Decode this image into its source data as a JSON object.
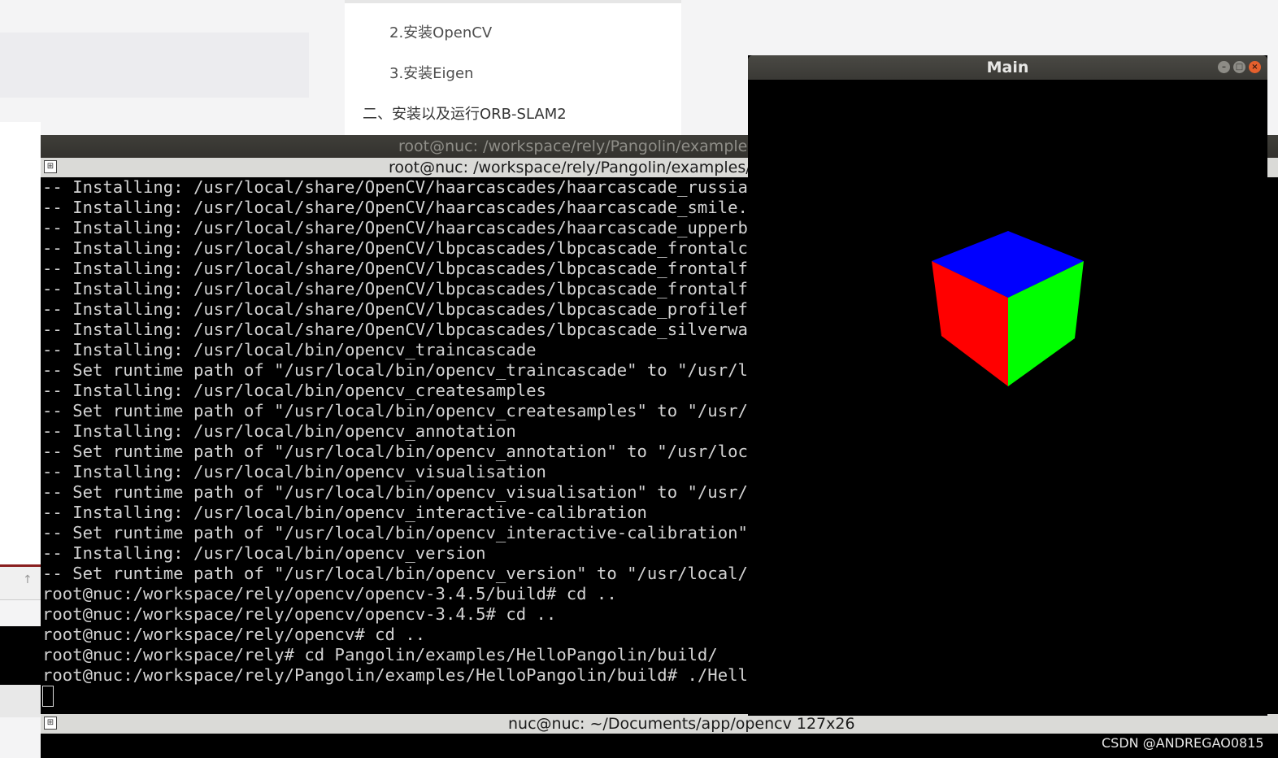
{
  "browser": {
    "toc": [
      {
        "label": "2.安装OpenCV"
      },
      {
        "label": "3.安装Eigen"
      },
      {
        "label": "二、安装以及运行ORB-SLAM2"
      }
    ]
  },
  "terminal": {
    "window_title": "root@nuc: /workspace/rely/Pangolin/examples/HelloPangolin/build",
    "tab_title": "root@nuc: /workspace/rely/Pangolin/examples/HelloPangolin/build",
    "lines": [
      "-- Installing: /usr/local/share/OpenCV/haarcascades/haarcascade_russian_p",
      "-- Installing: /usr/local/share/OpenCV/haarcascades/haarcascade_smile.xml",
      "-- Installing: /usr/local/share/OpenCV/haarcascades/haarcascade_upperbody",
      "-- Installing: /usr/local/share/OpenCV/lbpcascades/lbpcascade_frontalcatf",
      "-- Installing: /usr/local/share/OpenCV/lbpcascades/lbpcascade_frontalface",
      "-- Installing: /usr/local/share/OpenCV/lbpcascades/lbpcascade_frontalface",
      "-- Installing: /usr/local/share/OpenCV/lbpcascades/lbpcascade_profileface",
      "-- Installing: /usr/local/share/OpenCV/lbpcascades/lbpcascade_silverware.",
      "-- Installing: /usr/local/bin/opencv_traincascade",
      "-- Set runtime path of \"/usr/local/bin/opencv_traincascade\" to \"/usr/loca",
      "-- Installing: /usr/local/bin/opencv_createsamples",
      "-- Set runtime path of \"/usr/local/bin/opencv_createsamples\" to \"/usr/loc",
      "-- Installing: /usr/local/bin/opencv_annotation",
      "-- Set runtime path of \"/usr/local/bin/opencv_annotation\" to \"/usr/local/",
      "-- Installing: /usr/local/bin/opencv_visualisation",
      "-- Set runtime path of \"/usr/local/bin/opencv_visualisation\" to \"/usr/local/lib\"",
      "-- Installing: /usr/local/bin/opencv_interactive-calibration",
      "-- Set runtime path of \"/usr/local/bin/opencv_interactive-calibration\" to \"/usr/local/lib\"",
      "-- Installing: /usr/local/bin/opencv_version",
      "-- Set runtime path of \"/usr/local/bin/opencv_version\" to \"/usr/local/lib\"",
      "root@nuc:/workspace/rely/opencv/opencv-3.4.5/build# cd ..",
      "root@nuc:/workspace/rely/opencv/opencv-3.4.5# cd ..",
      "root@nuc:/workspace/rely/opencv# cd ..",
      "root@nuc:/workspace/rely# cd Pangolin/examples/HelloPangolin/build/",
      "root@nuc:/workspace/rely/Pangolin/examples/HelloPangolin/build# ./HelloPangolin"
    ],
    "status_title": "nuc@nuc: ~/Documents/app/opencv 127x26"
  },
  "main_window": {
    "title": "Main",
    "cube_colors": {
      "top": "#0000ff",
      "left": "#ff0000",
      "right": "#00ff00"
    }
  },
  "watermark": "CSDN @ANDREGAO0815"
}
